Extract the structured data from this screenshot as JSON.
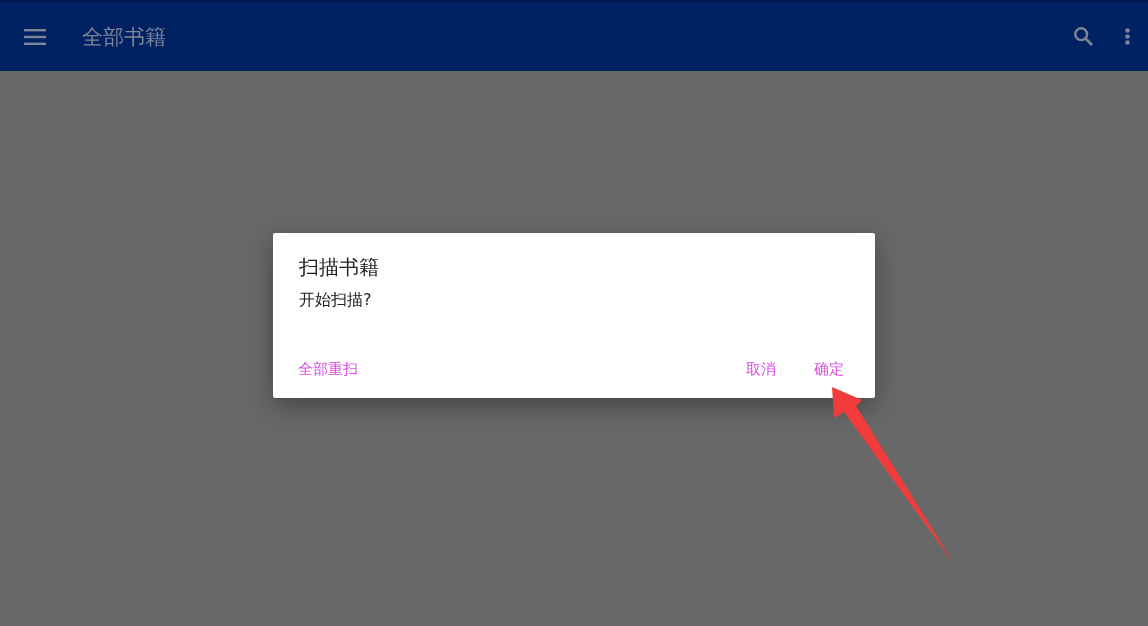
{
  "app_bar": {
    "title": "全部书籍"
  },
  "dialog": {
    "title": "扫描书籍",
    "message": "开始扫描?",
    "buttons": [
      {
        "label": "全部重扫",
        "kind": "neutral"
      },
      {
        "label": "取消",
        "kind": "negative"
      },
      {
        "label": "确定",
        "kind": "positive"
      }
    ]
  }
}
